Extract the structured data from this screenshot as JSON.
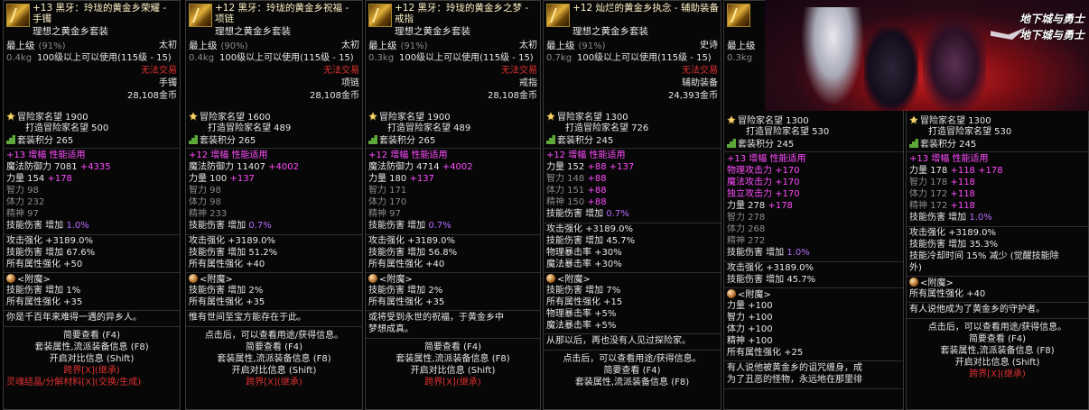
{
  "colors": {
    "gold": "#e7c46b",
    "pink": "#ff4cff",
    "red": "#e03030",
    "purple": "#b66cff"
  },
  "panels": [
    {
      "title": "+13 黑牙：玲珑的黄金乡荣耀 - 手镯",
      "subtitle": "理想之黄金乡套装",
      "level_label": "最上级",
      "level_pct": "(91%)",
      "grade": "太初",
      "weight": "0.4kg",
      "req": "100级以上可以使用(115级 - 15)",
      "trade": "无法交易",
      "slot": "手镯",
      "price": "28,108金币",
      "rep": "冒险家名望 1900",
      "forge": "打造冒险家名望 500",
      "set_points": "套装积分 265",
      "stats": [
        {
          "t": "+13 增幅 性能适用",
          "c": "pk"
        },
        {
          "t": "魔法防御力 7081 +4335",
          "c": "w",
          "a": "+4335"
        },
        {
          "t": "力量 154 +178",
          "c": "w",
          "a": "+178"
        },
        {
          "t": "智力 98",
          "c": "g"
        },
        {
          "t": "体力 232",
          "c": "g"
        },
        {
          "t": "精神 97",
          "c": "g"
        },
        {
          "t": "技能伤害 增加 1.0%",
          "c": "w",
          "a": "1.0%"
        }
      ],
      "stats2": [
        "攻击强化 +3189.0%",
        "技能伤害 增加 67.6%",
        "所有属性强化 +50"
      ],
      "enchant_title": "<附魔>",
      "enchant": [
        "技能伤害 增加 1%",
        "所有属性强化 +35"
      ],
      "flavor": [
        "你是千百年来难得一遇的异乡人。"
      ],
      "footer": [
        "简要查看 (F4)",
        "套装属性,流派装备信息 (F8)",
        "开启对比信息 (Shift)"
      ],
      "cross": "跨界[X](继承)",
      "extra": "灵魂结晶/分解材料[X](交换/生成)"
    },
    {
      "title": "+12 黑牙：玲珑的黄金乡祝福 - 项链",
      "subtitle": "理想之黄金乡套装",
      "level_label": "最上级",
      "level_pct": "(90%)",
      "grade": "太初",
      "weight": "0.4kg",
      "req": "100级以上可以使用(115级 - 15)",
      "trade": "无法交易",
      "slot": "项链",
      "price": "28,108金币",
      "rep": "冒险家名望 1600",
      "forge": "打造冒险家名望 489",
      "set_points": "套装积分 265",
      "stats": [
        {
          "t": "+12 增幅 性能适用",
          "c": "pk"
        },
        {
          "t": "魔法防御力 11407 +4002",
          "c": "w",
          "a": "+4002"
        },
        {
          "t": "力量 100 +137",
          "c": "w",
          "a": "+137"
        },
        {
          "t": "智力 98",
          "c": "g"
        },
        {
          "t": "体力 98",
          "c": "g"
        },
        {
          "t": "精神 233",
          "c": "g"
        },
        {
          "t": "技能伤害 增加 0.7%",
          "c": "w",
          "a": "0.7%"
        }
      ],
      "stats2": [
        "攻击强化 +3189.0%",
        "技能伤害 增加 51.2%",
        "所有属性强化 +40"
      ],
      "enchant_title": "<附魔>",
      "enchant": [
        "技能伤害 增加 2%",
        "所有属性强化 +35"
      ],
      "flavor": [
        "惟有世间至宝方能存在于此。"
      ],
      "footer": [
        "点击后，可以查看用途/获得信息。",
        "简要查看 (F4)",
        "套装属性,流派装备信息 (F8)",
        "开启对比信息 (Shift)"
      ],
      "cross": "跨界[X](继承)",
      "extra": ""
    },
    {
      "title": "+12 黑牙：玲珑的黄金乡之梦 - 戒指",
      "subtitle": "理想之黄金乡套装",
      "level_label": "最上级",
      "level_pct": "(91%)",
      "grade": "太初",
      "weight": "0.3kg",
      "req": "100级以上可以使用(115级 - 15)",
      "trade": "无法交易",
      "slot": "戒指",
      "price": "28,108金币",
      "rep": "冒险家名望 1900",
      "forge": "打造冒险家名望 489",
      "set_points": "套装积分 265",
      "stats": [
        {
          "t": "+12 增幅 性能适用",
          "c": "pk"
        },
        {
          "t": "魔法防御力 4714 +4002",
          "c": "w",
          "a": "+4002"
        },
        {
          "t": "力量 180 +137",
          "c": "w",
          "a": "+137"
        },
        {
          "t": "智力 171",
          "c": "g"
        },
        {
          "t": "体力 170",
          "c": "g"
        },
        {
          "t": "精神 97",
          "c": "g"
        },
        {
          "t": "技能伤害 增加 0.7%",
          "c": "w",
          "a": "0.7%"
        }
      ],
      "stats2": [
        "攻击强化 +3189.0%",
        "技能伤害 增加 56.8%",
        "所有属性强化 +40"
      ],
      "enchant_title": "<附魔>",
      "enchant": [
        "技能伤害 增加 2%",
        "所有属性强化 +35"
      ],
      "flavor": [
        "或将受到永世的祝福，于黄金乡中",
        "梦想成真。"
      ],
      "footer": [
        "简要查看 (F4)",
        "套装属性,流派装备信息 (F8)",
        "开启对比信息 (Shift)"
      ],
      "cross": "跨界[X](继承)",
      "extra": ""
    },
    {
      "title": "+12 灿烂的黄金乡执念 - 辅助装备",
      "subtitle": "理想之黄金乡套装",
      "level_label": "最上级",
      "level_pct": "(91%)",
      "grade": "史诗",
      "weight": "0.7kg",
      "req": "100级以上可以使用(115级 - 15)",
      "trade": "无法交易",
      "slot": "辅助装备",
      "price": "24,393金币",
      "rep": "冒险家名望 1300",
      "forge": "打造冒险家名望 726",
      "set_points": "套装积分 245",
      "stats": [
        {
          "t": "+12 增幅 性能适用",
          "c": "pk"
        },
        {
          "t": "力量 152 +88 +137",
          "c": "w",
          "a": "+88 +137"
        },
        {
          "t": "智力 148 +88",
          "c": "g",
          "a": "+88"
        },
        {
          "t": "体力 151 +88",
          "c": "g",
          "a": "+88"
        },
        {
          "t": "精神 150 +88",
          "c": "g",
          "a": "+88"
        },
        {
          "t": "技能伤害 增加 0.7%",
          "c": "w",
          "a": "0.7%"
        }
      ],
      "stats2": [
        "攻击强化 +3189.0%",
        "技能伤害 增加 45.7%",
        "物理暴击率 +30%",
        "魔法暴击率 +30%"
      ],
      "enchant_title": "<附魔>",
      "enchant": [
        "技能伤害 增加 7%",
        "所有属性强化 +15",
        "物理暴击率 +5%",
        "魔法暴击率 +5%"
      ],
      "flavor": [
        "从那以后，再也没有人见过探险家。"
      ],
      "footer": [
        "点击后，可以查看用途/获得信息。",
        "简要查看 (F4)",
        "套装属性,流派装备信息 (F8)"
      ],
      "cross": "",
      "extra": ""
    },
    {
      "title": "",
      "subtitle": "",
      "level_label": "最上级",
      "level_pct": "",
      "grade": "",
      "weight": "0.3kg",
      "req": "",
      "trade": "",
      "slot": "",
      "price": "",
      "rep": "冒险家名望 1300",
      "forge": "打造冒险家名望 530",
      "set_points": "套装积分 245",
      "stats": [
        {
          "t": "+13 增幅 性能适用",
          "c": "pk"
        },
        {
          "t": "物理攻击力 +170",
          "c": "pk"
        },
        {
          "t": "魔法攻击力 +170",
          "c": "pk"
        },
        {
          "t": "独立攻击力 +170",
          "c": "pk"
        },
        {
          "t": "力量 278 +178",
          "c": "w",
          "a": "+178"
        },
        {
          "t": "智力 278",
          "c": "g"
        },
        {
          "t": "体力 268",
          "c": "g"
        },
        {
          "t": "精神 272",
          "c": "g"
        },
        {
          "t": "技能伤害 增加 1.0%",
          "c": "w",
          "a": "1.0%"
        }
      ],
      "stats2": [
        "攻击强化 +3189.0%",
        "技能伤害 增加 45.7%"
      ],
      "enchant_title": "<附魔>",
      "enchant": [
        "力量 +100",
        "智力 +100",
        "体力 +100",
        "精神 +100",
        "所有属性强化 +25"
      ],
      "flavor": [
        "有人说他被黄金乡的诅咒缠身，成",
        "为了丑恶的怪物，永远地在那里徘"
      ],
      "footer": [],
      "cross": "",
      "extra": ""
    },
    {
      "title": "",
      "subtitle": "",
      "level_label": "",
      "level_pct": "",
      "grade": "",
      "weight": "",
      "req": "",
      "trade": "",
      "slot": "",
      "price": "",
      "rep": "冒险家名望 1300",
      "forge": "打造冒险家名望 530",
      "set_points": "套装积分 245",
      "stats": [
        {
          "t": "+13 增幅 性能适用",
          "c": "pk"
        },
        {
          "t": "力量 178 +118 +178",
          "c": "w",
          "a": "+118 +178"
        },
        {
          "t": "智力 178 +118",
          "c": "g",
          "a": "+118"
        },
        {
          "t": "体力 172 +118",
          "c": "g",
          "a": "+118"
        },
        {
          "t": "精神 172 +118",
          "c": "g",
          "a": "+118"
        },
        {
          "t": "技能伤害 增加 1.0%",
          "c": "w",
          "a": "1.0%"
        }
      ],
      "stats2": [
        "攻击强化 +3189.0%",
        "技能伤害 增加 35.3%",
        "技能冷却时间 15% 减少 (觉醒技能除",
        "外)"
      ],
      "enchant_title": "<附魔>",
      "enchant": [
        "所有属性强化 +40"
      ],
      "flavor": [
        "有人说他成为了黄金乡的守护者。"
      ],
      "footer": [
        "点击后，可以查看用途/获得信息。",
        "简要查看 (F4)",
        "套装属性,流派装备信息 (F8)",
        "开启对比信息 (Shift)"
      ],
      "cross": "跨界[X](继承)",
      "extra": ""
    }
  ],
  "banner": {
    "logo1": "地下城与勇士",
    "logo2": "地下城与勇士"
  }
}
